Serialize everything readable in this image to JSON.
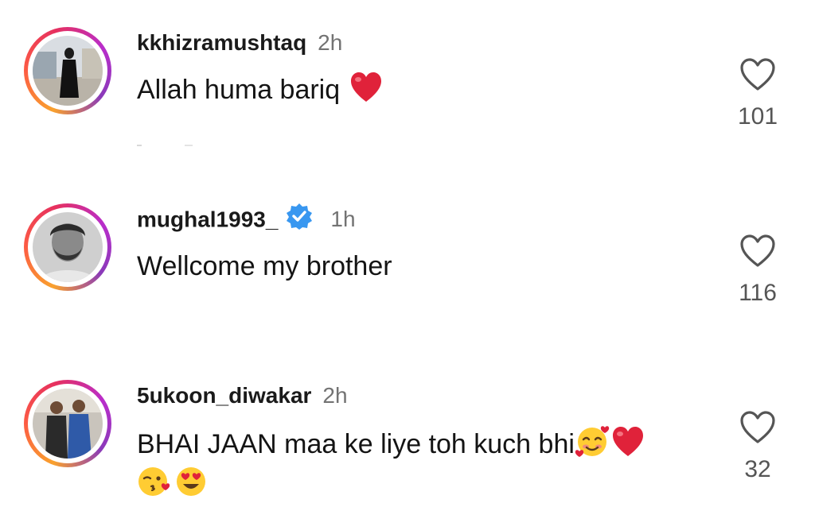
{
  "comments": [
    {
      "username": "kkhizramushtaq",
      "time": "2h",
      "verified": false,
      "text": "Allah huma bariq",
      "emojis": [
        "red-heart"
      ],
      "likes": "101",
      "avatar": "woman-in-black-abaya-photo"
    },
    {
      "username": "mughal1993_",
      "time": "1h",
      "verified": true,
      "text": "Wellcome my brother",
      "emojis": [],
      "likes": "116",
      "avatar": "bearded-man-portrait-photo"
    },
    {
      "username": "5ukoon_diwakar",
      "time": "2h",
      "verified": false,
      "text": "BHAI JAAN maa ke liye toh kuch bhi",
      "emojis": [
        "smiling-face-with-hearts",
        "red-heart",
        "face-blowing-kiss",
        "heart-eyes"
      ],
      "likes": "32",
      "avatar": "two-men-in-suits-photo"
    }
  ],
  "colors": {
    "story_ring_start": "#f9a12e",
    "story_ring_end": "#8a3ab9",
    "verified_blue": "#3897f0",
    "timestamp_gray": "#737373",
    "heart_red": "#e0223a"
  }
}
